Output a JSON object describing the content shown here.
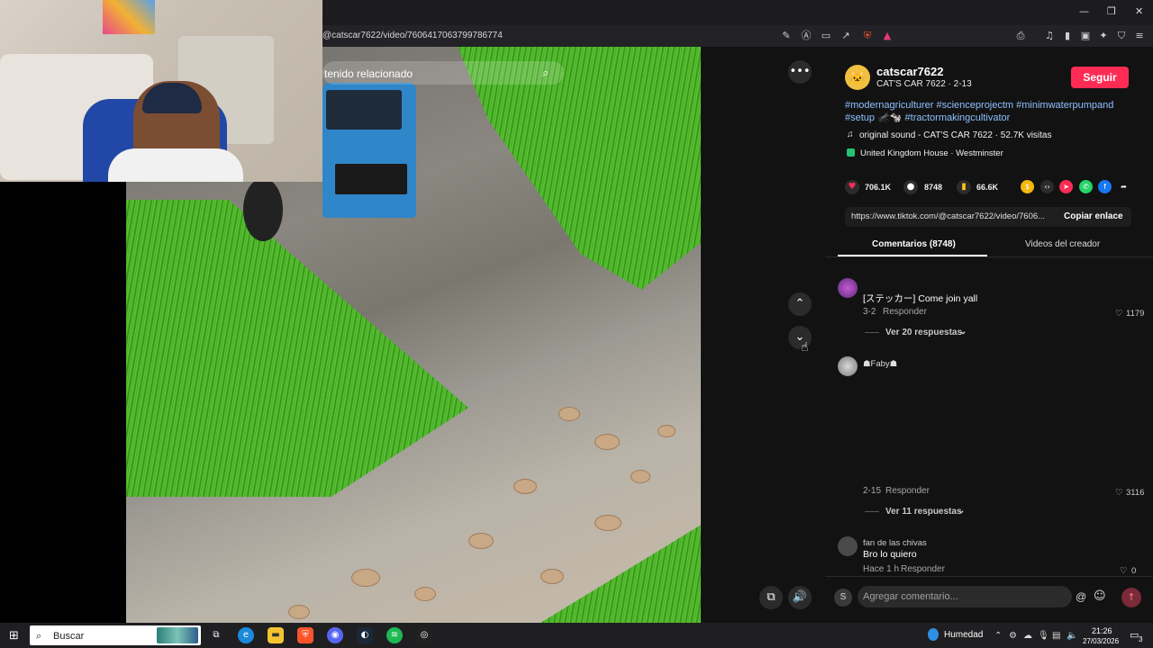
{
  "browser": {
    "url": "@catscar7622/video/7606417063799786774",
    "window_controls": [
      "—",
      "❐",
      "✕"
    ]
  },
  "video": {
    "search_placeholder": "tenido relacionado",
    "more_button": "•••",
    "up_button": "⌃",
    "down_button": "⌄"
  },
  "creator": {
    "avatar_emoji": "🐱",
    "username": "catscar7622",
    "subtitle": "CAT'S CAR 7622 · 2-13",
    "follow_label": "Seguir",
    "hashtags": "#modernagriculturer #scienceprojectm #minimwaterpumpand #setup 🦟🐄 #tractormakingcultivator",
    "sound": "original sound - CAT'S CAR 7622 · 52.7K visitas",
    "location": "United Kingdom House · Westminster"
  },
  "stats": {
    "likes": "706.1K",
    "comments": "8748",
    "saves": "66.6K"
  },
  "link": {
    "url": "https://www.tiktok.com/@catscar7622/video/7606...",
    "copy_label": "Copiar enlace"
  },
  "tabs": {
    "comments": "Comentarios (8748)",
    "videos": "Videos del creador"
  },
  "comments": [
    {
      "text": "[ステッカー] Come join yall",
      "date": "3-2",
      "reply_label": "Responder",
      "likes": "1179",
      "more_replies": "Ver 20 respuestas"
    },
    {
      "author": "☗Faby☗",
      "date": "2-15",
      "reply_label": "Responder",
      "likes": "3116",
      "more_replies": "Ver 11 respuestas"
    },
    {
      "author": "fan de las chivas",
      "text": "Bro lo quiero",
      "date": "Hace 1 h",
      "reply_label": "Responder",
      "likes": "0"
    }
  ],
  "composer": {
    "avatar_letter": "S",
    "placeholder": "Agregar comentario..."
  },
  "taskbar": {
    "search_label": "Buscar",
    "weather": "Humedad",
    "time": "21:26",
    "date": "27/03/2026",
    "notification_count": "3"
  },
  "colors": {
    "accent": "#fe2c55",
    "hashtag": "#8fc0ff",
    "panel_bg": "#121212"
  }
}
